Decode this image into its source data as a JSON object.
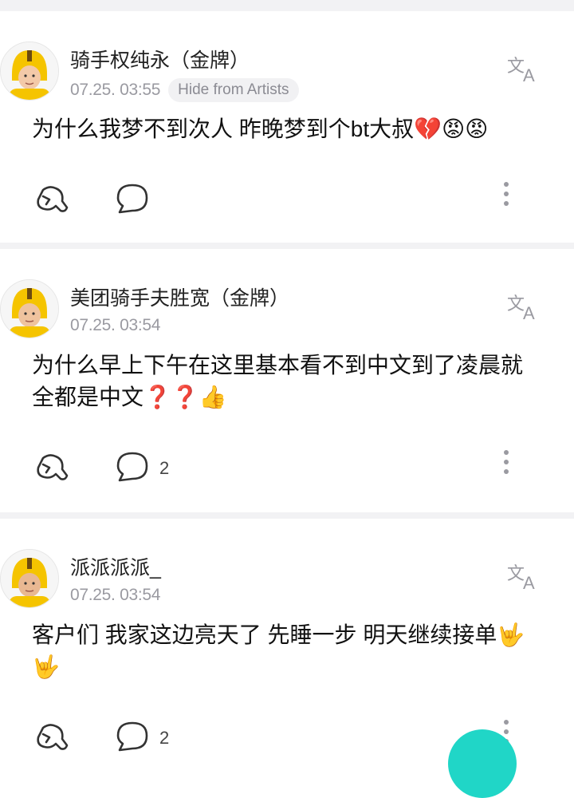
{
  "posts": [
    {
      "author": "骑手权纯永（金牌）",
      "date": "07.25. 03:55",
      "hide_label": "Hide from Artists",
      "text": "为什么我梦不到次人 昨晚梦到个bt大叔💔😡😡",
      "comment_count": ""
    },
    {
      "author": "美团骑手夫胜宽（金牌）",
      "date": "07.25. 03:54",
      "hide_label": "",
      "text": "为什么早上下午在这里基本看不到中文到了凌晨就全都是中文❓❓👍",
      "comment_count": "2"
    },
    {
      "author": "派派派派_",
      "date": "07.25. 03:54",
      "hide_label": "",
      "text": "客户们 我家这边亮天了 先睡一步 明天继续接单🤟🤟",
      "comment_count": "2"
    }
  ],
  "colors": {
    "accent": "#20d6c7",
    "muted": "#9a9aa1",
    "helmet": "#f5c400"
  },
  "icons": {
    "translate": "translate-icon",
    "like": "like-hand-icon",
    "comment": "comment-bubble-icon",
    "more": "more-vertical-icon"
  }
}
